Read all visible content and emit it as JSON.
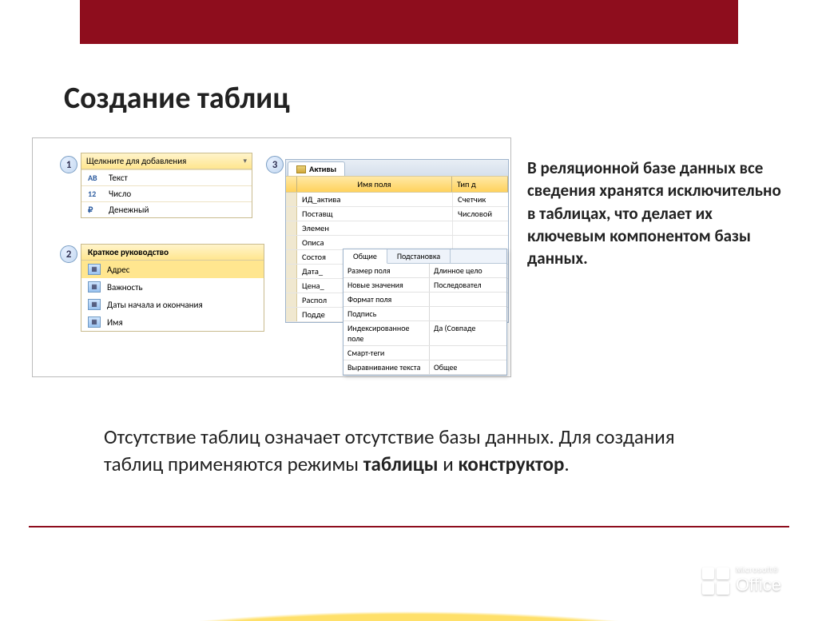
{
  "title": "Создание таблиц",
  "panel1": {
    "header": "Щелкните для добавления",
    "rows": [
      {
        "icon": "AB",
        "label": "Текст"
      },
      {
        "icon": "12",
        "label": "Число"
      },
      {
        "icon": "₽",
        "label": "Денежный"
      }
    ]
  },
  "panel2": {
    "header": "Краткое руководство",
    "rows": [
      {
        "label": "Адрес",
        "hl": true
      },
      {
        "label": "Важность",
        "hl": false
      },
      {
        "label": "Даты начала и окончания",
        "hl": false
      },
      {
        "label": "Имя",
        "hl": false
      }
    ]
  },
  "panel3": {
    "tab": "Активы",
    "header_field": "Имя поля",
    "header_type": "Тип д",
    "rows": [
      {
        "field": "ИД_актива",
        "type": "Счетчик"
      },
      {
        "field": "Поставщ",
        "type": "Числовой"
      },
      {
        "field": "Элемен",
        "type": ""
      },
      {
        "field": "Описа",
        "type": ""
      },
      {
        "field": "Состоя",
        "type": ""
      },
      {
        "field": "Дата_",
        "type": ""
      },
      {
        "field": "Цена_",
        "type": ""
      },
      {
        "field": "Распол",
        "type": ""
      },
      {
        "field": "Подде",
        "type": ""
      }
    ]
  },
  "props": {
    "tab_general": "Общие",
    "tab_lookup": "Подстановка",
    "rows": [
      {
        "k": "Размер поля",
        "v": "Длинное цело"
      },
      {
        "k": "Новые значения",
        "v": "Последовател"
      },
      {
        "k": "Формат поля",
        "v": ""
      },
      {
        "k": "Подпись",
        "v": ""
      },
      {
        "k": "Индексированное поле",
        "v": "Да (Совпаде"
      },
      {
        "k": "Смарт-теги",
        "v": ""
      },
      {
        "k": "Выравнивание текста",
        "v": "Общее"
      }
    ]
  },
  "text_right": "В реляционной базе данных все сведения хранятся исключительно в таблицах, что делает их ключевым компонентом базы данных.",
  "text_bottom_a": "Отсутствие таблиц означает отсутствие базы данных. Для создания таблиц применяются режимы ",
  "text_bottom_b1": "таблицы",
  "text_bottom_b_sep": " и ",
  "text_bottom_b2": "конструктор",
  "text_bottom_end": ".",
  "footer": {
    "brand_small": "Microsoft®",
    "brand": "Office"
  },
  "callouts": {
    "one": "1",
    "two": "2",
    "three": "3"
  }
}
